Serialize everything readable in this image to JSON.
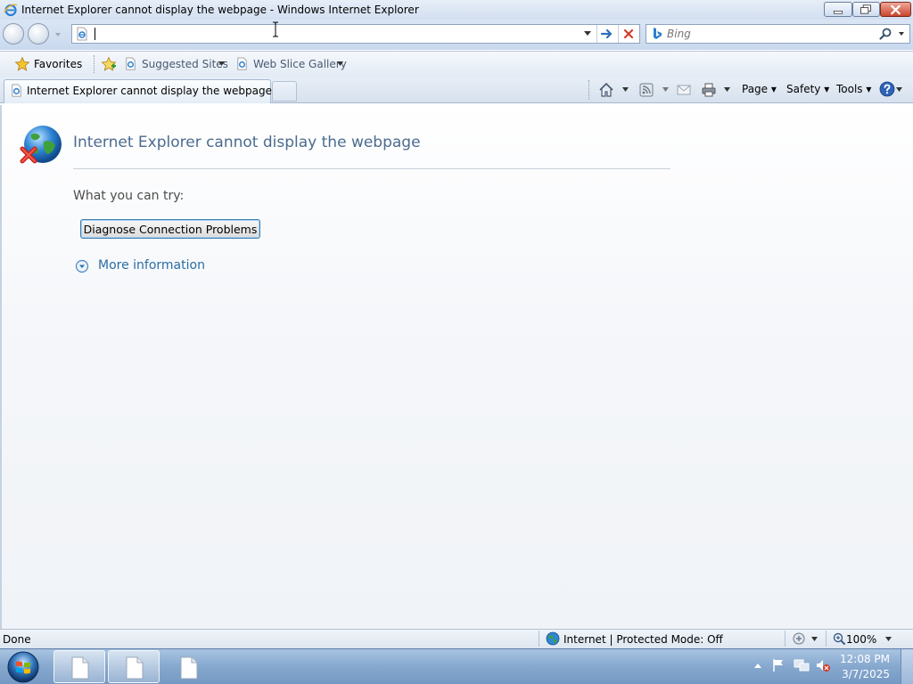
{
  "window": {
    "title": "Internet Explorer cannot display the webpage - Windows Internet Explorer"
  },
  "nav": {
    "address_value": "",
    "search_placeholder": "Bing"
  },
  "favorites_bar": {
    "favorites_label": "Favorites",
    "items": [
      {
        "label": "Suggested Sites"
      },
      {
        "label": "Web Slice Gallery"
      }
    ]
  },
  "tabs": [
    {
      "label": "Internet Explorer cannot display the webpage"
    }
  ],
  "command_bar": {
    "page": "Page",
    "safety": "Safety",
    "tools": "Tools"
  },
  "content": {
    "heading": "Internet Explorer cannot display the webpage",
    "try_label": "What you can try:",
    "diagnose_button": "Diagnose Connection Problems",
    "more_info_link": "More information"
  },
  "status_bar": {
    "status": "Done",
    "zone": "Internet | Protected Mode: Off",
    "zoom": "100%"
  },
  "taskbar": {
    "time": "12:08 PM",
    "date": "3/7/2025"
  },
  "colors": {
    "heading": "#4b6b8f",
    "link": "#2b6ea3",
    "chrome_blue": "#c9d9ee",
    "close_button": "#c9452c"
  },
  "icons": {
    "title": "ie-logo-icon",
    "error": "globe-error-icon",
    "search_provider": "bing-icon"
  }
}
